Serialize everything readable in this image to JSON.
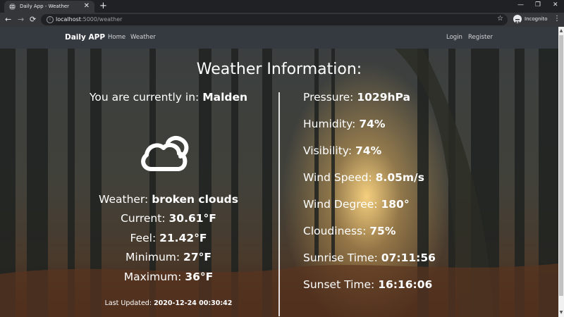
{
  "browser": {
    "tab_title": "Daily App - Weather",
    "tab_close": "✕",
    "new_tab": "+",
    "url_host": "localhost",
    "url_path": ":5000/weather",
    "profile_label": "Incognito",
    "icons": [
      "globe-icon",
      "close-icon",
      "plus-icon",
      "minimize-icon",
      "restore-icon",
      "close-window-icon",
      "back-arrow-icon",
      "forward-arrow-icon",
      "reload-icon",
      "info-icon",
      "star-icon",
      "incognito-icon",
      "kebab-menu-icon"
    ]
  },
  "navbar": {
    "brand": "Daily APP",
    "links": [
      "Home",
      "Weather"
    ],
    "right_links": [
      "Login",
      "Register"
    ]
  },
  "weather": {
    "heading": "Weather Information:",
    "location_label": "You are currently in:",
    "location": "Malden",
    "icon": "cloud-icon",
    "description_label": "Weather:",
    "description": "broken clouds",
    "current_label": "Current:",
    "current": "30.61°F",
    "feel_label": "Feel:",
    "feel": "21.42°F",
    "min_label": "Minimum:",
    "min": "27°F",
    "max_label": "Maximum:",
    "max": "36°F",
    "updated_label": "Last Updated:",
    "updated": "2020-12-24 00:30:42",
    "details": [
      {
        "label": "Pressure:",
        "value": "1029hPa"
      },
      {
        "label": "Humidity:",
        "value": "74%"
      },
      {
        "label": "Visibility:",
        "value": "74%"
      },
      {
        "label": "Wind Speed:",
        "value": "8.05m/s"
      },
      {
        "label": "Wind Degree:",
        "value": "180°"
      },
      {
        "label": "Cloudiness:",
        "value": "75%"
      },
      {
        "label": "Sunrise Time:",
        "value": "07:11:56"
      },
      {
        "label": "Sunset Time:",
        "value": "16:16:06"
      }
    ]
  }
}
